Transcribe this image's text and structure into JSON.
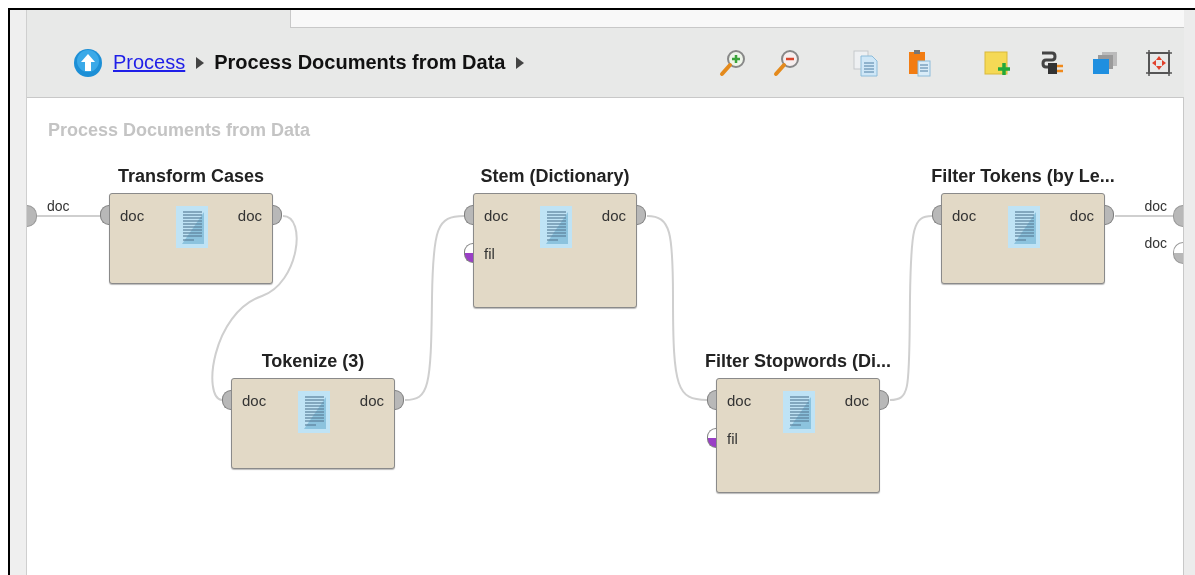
{
  "breadcrumb": {
    "items": [
      {
        "label": "Process",
        "kind": "link"
      },
      {
        "label": "Process Documents from Data",
        "kind": "current"
      }
    ]
  },
  "canvas": {
    "title": "Process Documents from Data",
    "input_ports": [
      {
        "label": "doc",
        "kind": "doc",
        "connected": true
      }
    ],
    "output_ports": [
      {
        "label": "doc",
        "kind": "doc",
        "connected": true
      },
      {
        "label": "doc",
        "kind": "doc",
        "connected": false
      }
    ],
    "nodes": [
      {
        "title": "Transform Cases",
        "inputs": [
          {
            "label": "doc",
            "kind": "doc",
            "connected": true
          }
        ],
        "outputs": [
          {
            "label": "doc",
            "kind": "doc",
            "connected": true
          }
        ]
      },
      {
        "title": "Tokenize (3)",
        "inputs": [
          {
            "label": "doc",
            "kind": "doc",
            "connected": true
          }
        ],
        "outputs": [
          {
            "label": "doc",
            "kind": "doc",
            "connected": true
          }
        ]
      },
      {
        "title": "Stem (Dictionary)",
        "inputs": [
          {
            "label": "doc",
            "kind": "doc",
            "connected": true
          },
          {
            "label": "fil",
            "kind": "fil",
            "connected": false
          }
        ],
        "outputs": [
          {
            "label": "doc",
            "kind": "doc",
            "connected": true
          }
        ]
      },
      {
        "title": "Filter Stopwords (Di...",
        "inputs": [
          {
            "label": "doc",
            "kind": "doc",
            "connected": true
          },
          {
            "label": "fil",
            "kind": "fil",
            "connected": false
          }
        ],
        "outputs": [
          {
            "label": "doc",
            "kind": "doc",
            "connected": true
          }
        ]
      },
      {
        "title": "Filter Tokens (by Le...",
        "inputs": [
          {
            "label": "doc",
            "kind": "doc",
            "connected": true
          }
        ],
        "outputs": [
          {
            "label": "doc",
            "kind": "doc",
            "connected": true
          }
        ]
      }
    ]
  }
}
